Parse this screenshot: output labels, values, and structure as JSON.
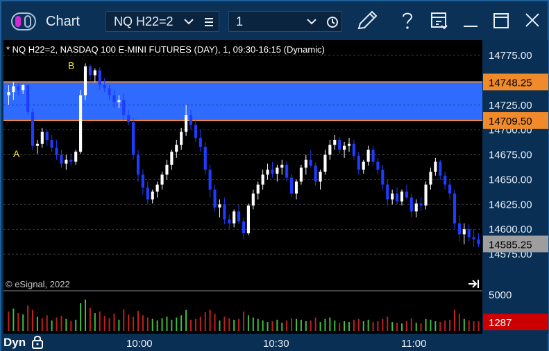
{
  "window": {
    "title": "Chart",
    "symbol_field": "NQ H22=2",
    "interval_field": "1"
  },
  "chart_header": "* NQ H22=2, NASDAQ 100 E-MINI FUTURES (DAY), 1, 09:30-16:15 (Dynamic)",
  "copyright": "© eSignal, 2022",
  "footer": {
    "mode": "Dyn"
  },
  "colors": {
    "background": "#000000",
    "up_candle": "#ffffff",
    "down_candle": "#1e3cff",
    "zone_fill": "#2f6bff",
    "zone_border": "#f08a2a",
    "price_tag_zone": "#f08a2a",
    "last_price_tag": "#9e9e9e",
    "volume_tag": "#cc0000",
    "vol_up": "#3fbf3f",
    "vol_down": "#c02020"
  },
  "chart_data": {
    "type": "candlestick",
    "symbol": "NQ H22=2",
    "interval": "1",
    "y_axis": {
      "ticks": [
        "14775.00",
        "14725.00",
        "14700.00",
        "14675.00",
        "14650.00",
        "14625.00",
        "14600.00",
        "14575.00"
      ],
      "range": [
        14570,
        14790
      ]
    },
    "x_axis": {
      "ticks": [
        "10:00",
        "10:30",
        "11:00"
      ]
    },
    "zone": {
      "top": 14748.25,
      "bottom": 14709.5
    },
    "price_tags": {
      "zone_top": "14748.25",
      "zone_bottom": "14709.50",
      "last": "14585.25"
    },
    "points": [
      {
        "label": "A",
        "price": 14676
      },
      {
        "label": "B",
        "price": 14765
      }
    ],
    "volume": {
      "axis_label": "5000",
      "axis_max": 5000,
      "last_volume": "1287"
    },
    "candles": [
      [
        14735,
        14745,
        14725,
        14738
      ],
      [
        14738,
        14748,
        14730,
        14744
      ],
      [
        14744,
        14747,
        14735,
        14740
      ],
      [
        14740,
        14746,
        14736,
        14745
      ],
      [
        14745,
        14746,
        14715,
        14718
      ],
      [
        14718,
        14722,
        14680,
        14684
      ],
      [
        14684,
        14690,
        14676,
        14686
      ],
      [
        14686,
        14702,
        14682,
        14698
      ],
      [
        14698,
        14700,
        14684,
        14690
      ],
      [
        14690,
        14695,
        14678,
        14682
      ],
      [
        14682,
        14690,
        14670,
        14675
      ],
      [
        14675,
        14680,
        14662,
        14666
      ],
      [
        14666,
        14675,
        14660,
        14670
      ],
      [
        14670,
        14676,
        14664,
        14668
      ],
      [
        14668,
        14680,
        14665,
        14678
      ],
      [
        14678,
        14740,
        14676,
        14735
      ],
      [
        14735,
        14767,
        14730,
        14764
      ],
      [
        14764,
        14766,
        14750,
        14755
      ],
      [
        14755,
        14762,
        14748,
        14760
      ],
      [
        14760,
        14763,
        14740,
        14745
      ],
      [
        14745,
        14752,
        14738,
        14742
      ],
      [
        14742,
        14745,
        14730,
        14735
      ],
      [
        14735,
        14740,
        14722,
        14728
      ],
      [
        14728,
        14735,
        14722,
        14730
      ],
      [
        14730,
        14736,
        14710,
        14715
      ],
      [
        14715,
        14720,
        14705,
        14708
      ],
      [
        14708,
        14712,
        14670,
        14675
      ],
      [
        14675,
        14680,
        14648,
        14655
      ],
      [
        14655,
        14660,
        14635,
        14642
      ],
      [
        14642,
        14648,
        14625,
        14630
      ],
      [
        14630,
        14640,
        14626,
        14638
      ],
      [
        14638,
        14648,
        14632,
        14645
      ],
      [
        14645,
        14658,
        14640,
        14655
      ],
      [
        14655,
        14670,
        14650,
        14665
      ],
      [
        14665,
        14680,
        14660,
        14678
      ],
      [
        14678,
        14690,
        14672,
        14685
      ],
      [
        14685,
        14702,
        14680,
        14698
      ],
      [
        14698,
        14725,
        14694,
        14715
      ],
      [
        14715,
        14720,
        14700,
        14705
      ],
      [
        14705,
        14710,
        14688,
        14692
      ],
      [
        14692,
        14700,
        14678,
        14683
      ],
      [
        14683,
        14688,
        14655,
        14660
      ],
      [
        14660,
        14665,
        14632,
        14640
      ],
      [
        14640,
        14645,
        14618,
        14622
      ],
      [
        14622,
        14630,
        14612,
        14625
      ],
      [
        14625,
        14632,
        14605,
        14610
      ],
      [
        14610,
        14615,
        14600,
        14606
      ],
      [
        14606,
        14620,
        14602,
        14618
      ],
      [
        14618,
        14625,
        14605,
        14608
      ],
      [
        14608,
        14612,
        14590,
        14596
      ],
      [
        14596,
        14626,
        14594,
        14624
      ],
      [
        14624,
        14640,
        14620,
        14636
      ],
      [
        14636,
        14648,
        14630,
        14645
      ],
      [
        14645,
        14660,
        14640,
        14655
      ],
      [
        14655,
        14666,
        14650,
        14660
      ],
      [
        14660,
        14668,
        14652,
        14656
      ],
      [
        14656,
        14665,
        14648,
        14662
      ],
      [
        14662,
        14670,
        14655,
        14665
      ],
      [
        14665,
        14668,
        14648,
        14652
      ],
      [
        14652,
        14656,
        14632,
        14636
      ],
      [
        14636,
        14650,
        14630,
        14648
      ],
      [
        14648,
        14665,
        14645,
        14662
      ],
      [
        14662,
        14675,
        14655,
        14670
      ],
      [
        14670,
        14680,
        14662,
        14664
      ],
      [
        14664,
        14667,
        14644,
        14648
      ],
      [
        14648,
        14660,
        14640,
        14658
      ],
      [
        14658,
        14680,
        14655,
        14675
      ],
      [
        14675,
        14690,
        14670,
        14685
      ],
      [
        14685,
        14695,
        14680,
        14690
      ],
      [
        14690,
        14693,
        14676,
        14680
      ],
      [
        14680,
        14688,
        14672,
        14684
      ],
      [
        14684,
        14692,
        14678,
        14686
      ],
      [
        14686,
        14690,
        14670,
        14674
      ],
      [
        14674,
        14678,
        14655,
        14660
      ],
      [
        14660,
        14670,
        14656,
        14668
      ],
      [
        14668,
        14684,
        14664,
        14680
      ],
      [
        14680,
        14684,
        14664,
        14668
      ],
      [
        14668,
        14672,
        14655,
        14660
      ],
      [
        14660,
        14665,
        14640,
        14645
      ],
      [
        14645,
        14650,
        14624,
        14630
      ],
      [
        14630,
        14640,
        14625,
        14636
      ],
      [
        14636,
        14642,
        14625,
        14628
      ],
      [
        14628,
        14640,
        14624,
        14638
      ],
      [
        14638,
        14645,
        14630,
        14632
      ],
      [
        14632,
        14636,
        14612,
        14618
      ],
      [
        14618,
        14630,
        14612,
        14626
      ],
      [
        14626,
        14632,
        14618,
        14624
      ],
      [
        14624,
        14648,
        14620,
        14645
      ],
      [
        14645,
        14662,
        14640,
        14658
      ],
      [
        14658,
        14672,
        14654,
        14668
      ],
      [
        14668,
        14670,
        14650,
        14654
      ],
      [
        14654,
        14658,
        14640,
        14645
      ],
      [
        14645,
        14650,
        14630,
        14636
      ],
      [
        14636,
        14640,
        14600,
        14606
      ],
      [
        14606,
        14614,
        14588,
        14595
      ],
      [
        14595,
        14606,
        14585,
        14600
      ],
      [
        14600,
        14605,
        14588,
        14592
      ],
      [
        14592,
        14600,
        14582,
        14590
      ],
      [
        14590,
        14596,
        14582,
        14585
      ]
    ],
    "volumes": [
      [
        2600,
        0
      ],
      [
        3000,
        1
      ],
      [
        2400,
        0
      ],
      [
        2200,
        1
      ],
      [
        3400,
        0
      ],
      [
        2800,
        0
      ],
      [
        1900,
        1
      ],
      [
        1700,
        0
      ],
      [
        2100,
        0
      ],
      [
        1400,
        1
      ],
      [
        1800,
        0
      ],
      [
        2000,
        0
      ],
      [
        1600,
        1
      ],
      [
        1300,
        0
      ],
      [
        1500,
        1
      ],
      [
        3700,
        1
      ],
      [
        4200,
        1
      ],
      [
        3100,
        0
      ],
      [
        2400,
        1
      ],
      [
        2600,
        0
      ],
      [
        2000,
        0
      ],
      [
        1700,
        0
      ],
      [
        2300,
        0
      ],
      [
        1500,
        1
      ],
      [
        2900,
        0
      ],
      [
        2200,
        0
      ],
      [
        1900,
        0
      ],
      [
        2700,
        0
      ],
      [
        2100,
        0
      ],
      [
        1800,
        0
      ],
      [
        1600,
        1
      ],
      [
        1400,
        1
      ],
      [
        1700,
        1
      ],
      [
        1900,
        1
      ],
      [
        1500,
        1
      ],
      [
        1800,
        1
      ],
      [
        2100,
        1
      ],
      [
        2800,
        1
      ],
      [
        1500,
        0
      ],
      [
        1600,
        0
      ],
      [
        1900,
        0
      ],
      [
        2500,
        0
      ],
      [
        2800,
        0
      ],
      [
        2300,
        0
      ],
      [
        1400,
        1
      ],
      [
        1900,
        0
      ],
      [
        1700,
        0
      ],
      [
        1500,
        1
      ],
      [
        1600,
        0
      ],
      [
        2600,
        0
      ],
      [
        2100,
        1
      ],
      [
        1800,
        1
      ],
      [
        1600,
        1
      ],
      [
        1400,
        1
      ],
      [
        1200,
        1
      ],
      [
        1300,
        0
      ],
      [
        1500,
        1
      ],
      [
        1100,
        1
      ],
      [
        1400,
        0
      ],
      [
        1700,
        0
      ],
      [
        1600,
        1
      ],
      [
        1500,
        1
      ],
      [
        1300,
        1
      ],
      [
        1400,
        0
      ],
      [
        1800,
        0
      ],
      [
        1200,
        1
      ],
      [
        1600,
        1
      ],
      [
        1800,
        1
      ],
      [
        1400,
        1
      ],
      [
        1100,
        0
      ],
      [
        1300,
        1
      ],
      [
        1200,
        1
      ],
      [
        1500,
        0
      ],
      [
        1600,
        0
      ],
      [
        1300,
        1
      ],
      [
        1500,
        1
      ],
      [
        1200,
        0
      ],
      [
        1300,
        0
      ],
      [
        1600,
        0
      ],
      [
        1900,
        0
      ],
      [
        1200,
        1
      ],
      [
        1100,
        0
      ],
      [
        1000,
        1
      ],
      [
        1300,
        0
      ],
      [
        1700,
        0
      ],
      [
        1100,
        1
      ],
      [
        1000,
        0
      ],
      [
        1600,
        1
      ],
      [
        1500,
        1
      ],
      [
        1300,
        1
      ],
      [
        1200,
        0
      ],
      [
        1400,
        0
      ],
      [
        1500,
        0
      ],
      [
        2800,
        0
      ],
      [
        2300,
        0
      ],
      [
        1600,
        1
      ],
      [
        1400,
        0
      ],
      [
        1300,
        0
      ],
      [
        1287,
        0
      ]
    ]
  }
}
